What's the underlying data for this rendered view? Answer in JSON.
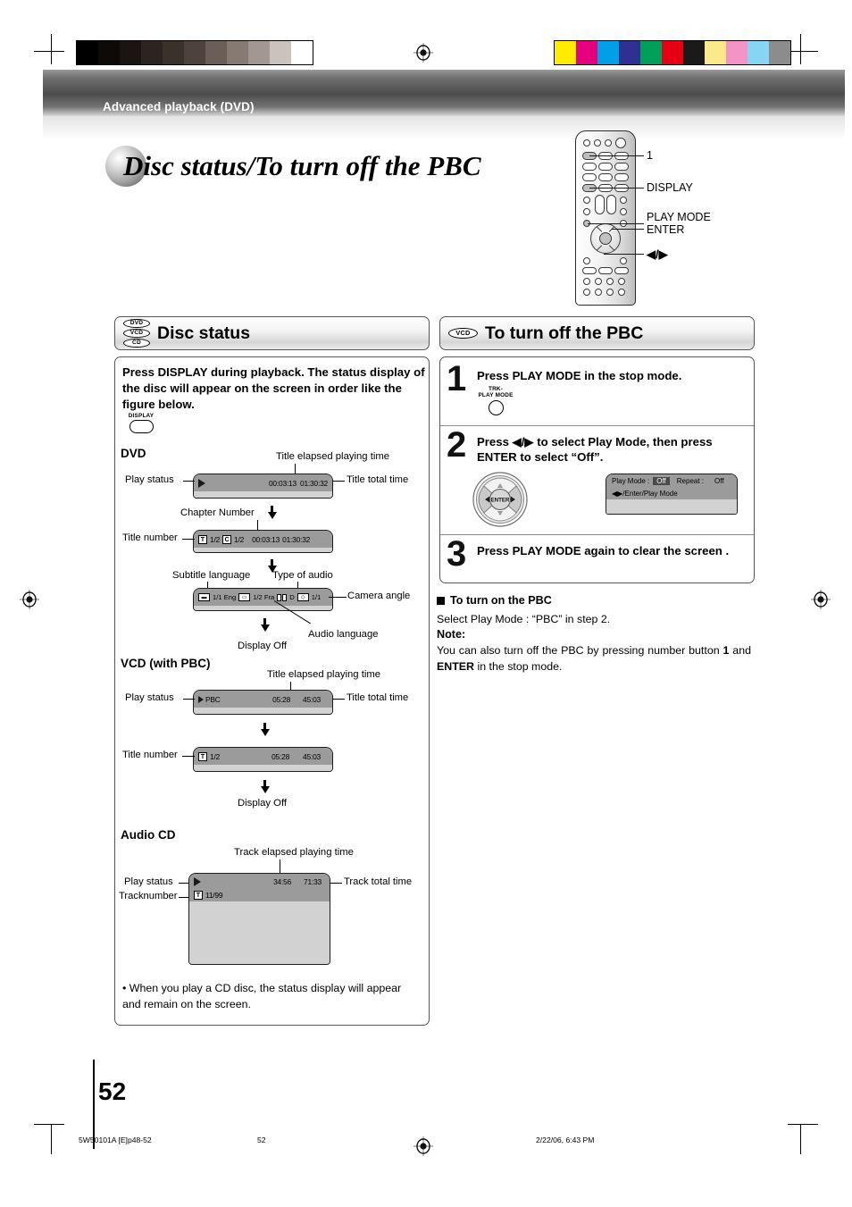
{
  "page": {
    "banner_title": "Advanced playback (DVD)",
    "heading": "Disc status/To turn off the PBC",
    "page_number": "52"
  },
  "footer": {
    "left": "5W50101A [E]p48-52",
    "center": "52",
    "right": "2/22/06, 6:43 PM"
  },
  "remote": {
    "callouts": [
      {
        "label": "1"
      },
      {
        "label": "DISPLAY"
      },
      {
        "label": "PLAY MODE"
      },
      {
        "label": "ENTER"
      },
      {
        "label": "◀/▶"
      }
    ]
  },
  "left_section": {
    "badges": [
      "DVD",
      "VCD",
      "CD"
    ],
    "title": "Disc status",
    "intro": "Press DISPLAY during playback. The status display of the disc will appear on the screen in order like the figure below.",
    "display_button_label": "DISPLAY",
    "dvd": {
      "heading": "DVD",
      "labels": {
        "elapsed": "Title elapsed playing time",
        "play_status": "Play status",
        "total": "Title total time",
        "chapter": "Chapter Number",
        "title_number": "Title number",
        "subtitle_language": "Subtitle language",
        "type_of_audio": "Type of audio",
        "camera_angle": "Camera angle",
        "audio_language": "Audio language",
        "display_off": "Display Off"
      },
      "bar1": {
        "elapsed": "00:03:13",
        "total": "01:30:32"
      },
      "bar2": {
        "title": "1/2",
        "chapter": "1/2",
        "elapsed": "00:03:13",
        "total": "01:30:32"
      },
      "bar3": {
        "subtitle": "1/1 Eng",
        "audio": "1/2 Fra",
        "audio_type": "D",
        "angle": "1/1"
      }
    },
    "vcd": {
      "heading": "VCD (with PBC)",
      "labels": {
        "elapsed": "Title elapsed playing time",
        "play_status": "Play status",
        "total": "Title total time",
        "title_number": "Title number",
        "display_off": "Display Off"
      },
      "bar1": {
        "mode": "PBC",
        "elapsed": "05:28",
        "total": "45:03"
      },
      "bar2": {
        "title": "1/2",
        "elapsed": "05:28",
        "total": "45:03"
      }
    },
    "cd": {
      "heading": "Audio CD",
      "labels": {
        "elapsed": "Track elapsed playing time",
        "play_status": "Play status",
        "track_number": "Tracknumber",
        "total": "Track total time"
      },
      "bar": {
        "elapsed": "34:56",
        "total": "71:33",
        "track": "11/99"
      }
    },
    "bullet_note": "• When you play a CD disc, the status display will appear and remain on the screen."
  },
  "right_section": {
    "badge": "VCD",
    "title": "To turn off the PBC",
    "steps": [
      {
        "number": "1",
        "text": "Press PLAY MODE in the stop mode.",
        "button_caption_line1": "TRK-",
        "button_caption_line2": "PLAY MODE"
      },
      {
        "number": "2",
        "text": "Press ◀/▶ to select Play Mode, then press ENTER to select “Off”.",
        "dpad_label": "ENTER",
        "osd": {
          "play_mode_label": "Play Mode :",
          "play_mode_value": "Off",
          "repeat_label": "Repeat :",
          "repeat_value": "Off",
          "hint": "◀▶/Enter/Play Mode"
        }
      },
      {
        "number": "3",
        "text": "Press PLAY MODE again to clear the screen ."
      }
    ],
    "turn_on": {
      "heading": "To turn on the PBC",
      "line1": "Select Play Mode : “PBC” in step 2.",
      "note_label": "Note:",
      "note_line1": "You can also turn off the PBC by pressing number button ",
      "note_bold1": "1",
      "note_line2": " and ",
      "note_bold2": "ENTER",
      "note_line3": " in the stop mode."
    }
  },
  "calibration": {
    "gray_ramp": [
      "#000000",
      "#0d0a08",
      "#1a1512",
      "#2b2420",
      "#3a312b",
      "#4e433c",
      "#6b5e56",
      "#877a72",
      "#a39891",
      "#c9c2bd",
      "#ffffff"
    ],
    "color_swatches": [
      "#ffec00",
      "#e5007e",
      "#00a0e9",
      "#2e3192",
      "#00a05a",
      "#e60012",
      "#1a1a1a",
      "#fbe98a",
      "#f493c5",
      "#86d5f5",
      "#8c8c8c"
    ]
  }
}
